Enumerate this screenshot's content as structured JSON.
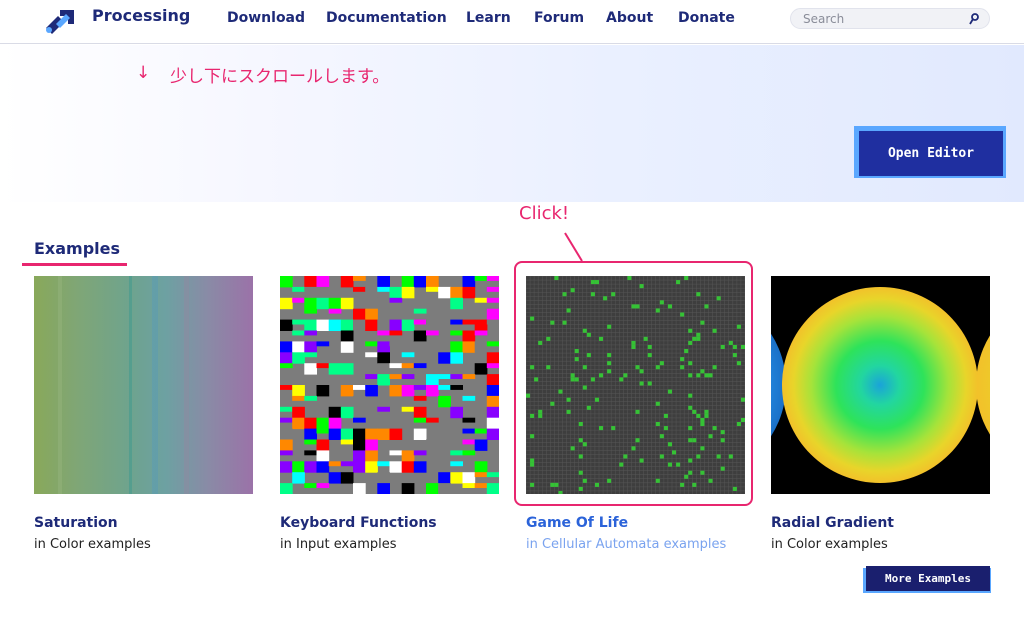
{
  "header": {
    "brand": "Processing",
    "nav": [
      "Download",
      "Documentation",
      "Learn",
      "Forum",
      "About",
      "Donate"
    ],
    "search": {
      "placeholder": "Search",
      "value": ""
    }
  },
  "hero": {
    "hint_arrow": "↓",
    "hint_text": "少し下にスクロールします。",
    "open_editor": "Open Editor"
  },
  "annotation": {
    "click_label": "Click!"
  },
  "examples": {
    "title": "Examples",
    "cards": [
      {
        "title": "Saturation",
        "subtitle": "in Color examples"
      },
      {
        "title": "Keyboard Functions",
        "subtitle": "in Input examples"
      },
      {
        "title": "Game Of Life",
        "subtitle": "in Cellular Automata examples"
      },
      {
        "title": "Radial Gradient",
        "subtitle": "in Color examples"
      }
    ],
    "more_button": "More Examples"
  },
  "colors": {
    "brand_navy": "#1e2a78",
    "accent_pink": "#e8266f",
    "button_blue": "#1f2fa0",
    "button_shadow": "#5aa7ff",
    "active_link": "#2b63d9"
  }
}
